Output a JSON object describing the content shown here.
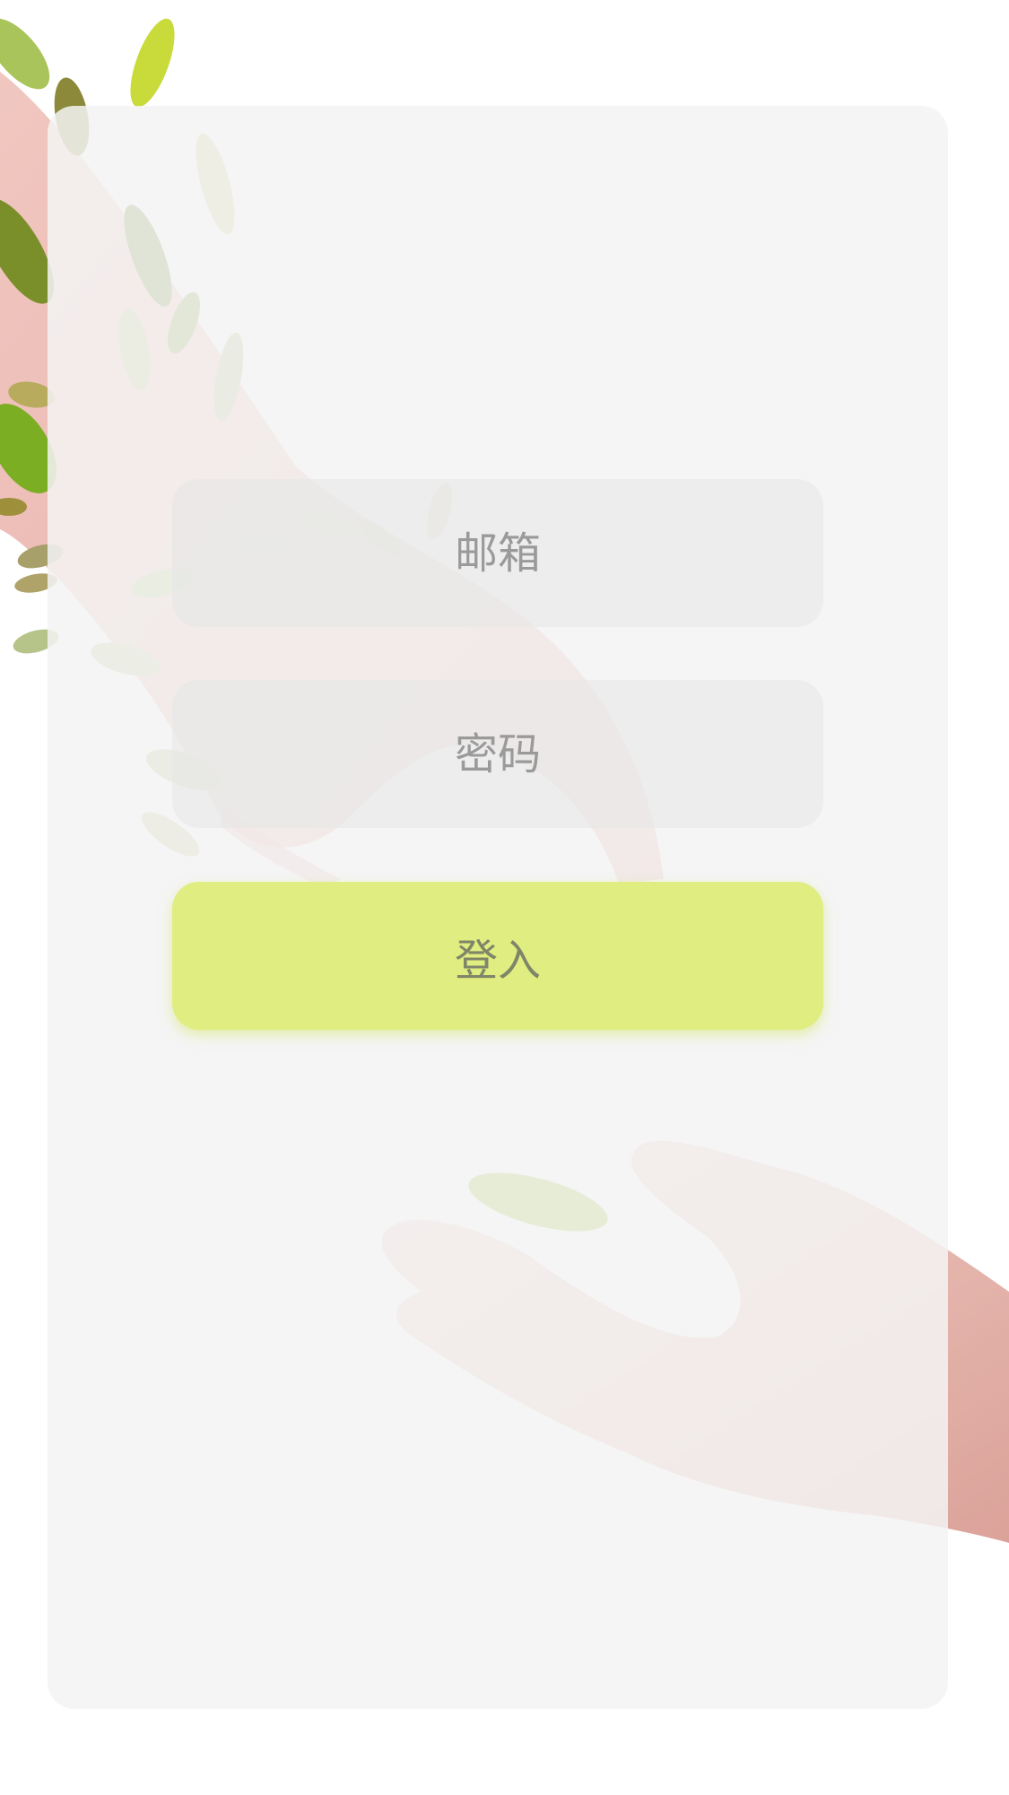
{
  "login_form": {
    "email_placeholder": "邮箱",
    "password_placeholder": "密码",
    "login_label": "登入"
  },
  "colors": {
    "button": "#e0ed80",
    "card": "#f3f3f3",
    "field": "#e9e9e9",
    "placeholder_text": "#9a9a9a",
    "skin": "#e7b3ab",
    "leaf": "#9cbf2f"
  },
  "illustration": {
    "icons": [
      "falling-leaves-icon",
      "reaching-hand-icon",
      "open-palm-icon"
    ]
  }
}
